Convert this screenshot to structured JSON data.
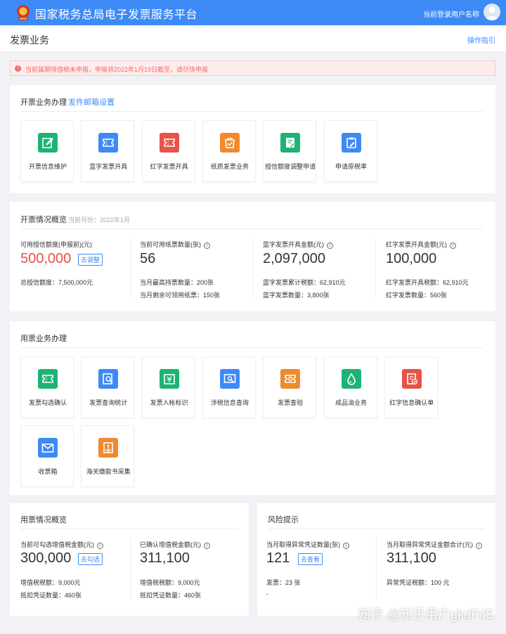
{
  "header": {
    "title": "国家税务总局电子发票服务平台",
    "user_label": "当前登录用户名称"
  },
  "page": {
    "title": "发票业务",
    "guide_label": "操作指引"
  },
  "notice": {
    "text": "当前属期增值税未申报，申报将2022年1月19日截至，请尽快申报"
  },
  "invoicing_business": {
    "title": "开票业务办理",
    "email_link": "发件邮箱设置",
    "tiles": [
      {
        "label": "开票信息维护",
        "icon": "edit-doc-icon",
        "color": "#1db375"
      },
      {
        "label": "蓝字发票开具",
        "icon": "ticket-icon",
        "color": "#3d8af7"
      },
      {
        "label": "红字发票开具",
        "icon": "ticket-icon",
        "color": "#e65348"
      },
      {
        "label": "纸质发票业务",
        "icon": "paper-bag-icon",
        "color": "#ef8a2f"
      },
      {
        "label": "授信额度调整申请",
        "icon": "doc-pen-icon",
        "color": "#1db375"
      },
      {
        "label": "申请原税率",
        "icon": "clipboard-pen-icon",
        "color": "#3d8af7"
      }
    ]
  },
  "invoicing_overview": {
    "title": "开票情况概览",
    "month_label": "当前月份：2022年1月",
    "stats": [
      {
        "label": "可用授信额度(申报前)(元)",
        "value": "500,000",
        "button": "去调整",
        "lines": [
          "总授信额度：7,500,000元"
        ]
      },
      {
        "label": "当前可用纸票数量(张)",
        "value": "56",
        "lines": [
          "当月最高持票数量：200张",
          "当月剩余可领用纸票：150张"
        ]
      },
      {
        "label": "蓝字发票开具金额(元)",
        "value": "2,097,000",
        "lines": [
          "蓝字发票累计税额：62,910元",
          "蓝字发票数量：3,800张"
        ]
      },
      {
        "label": "红字发票开具金额(元)",
        "value": "100,000",
        "lines": [
          "红字发票开具税额：62,910元",
          "红字发票数量：560张"
        ]
      }
    ]
  },
  "usage_business": {
    "title": "用票业务办理",
    "tiles": [
      {
        "label": "发票勾选确认",
        "icon": "ticket-icon",
        "color": "#1db375"
      },
      {
        "label": "发票查询统计",
        "icon": "search-doc-icon",
        "color": "#3d8af7"
      },
      {
        "label": "发票入帐标识",
        "icon": "ledger-icon",
        "color": "#1db375"
      },
      {
        "label": "涉税信息查询",
        "icon": "monitor-search-icon",
        "color": "#3d8af7"
      },
      {
        "label": "发票查验",
        "icon": "ticket-check-icon",
        "color": "#ef8a2f"
      },
      {
        "label": "成品油业务",
        "icon": "oil-drop-icon",
        "color": "#1db375"
      },
      {
        "label": "红字信息确认单",
        "icon": "doc-check-icon",
        "color": "#e65348"
      },
      {
        "label": "收票箱",
        "icon": "mail-icon",
        "color": "#3d8af7"
      },
      {
        "label": "海关缴款书采集",
        "icon": "anchor-doc-icon",
        "color": "#ef8a2f"
      }
    ]
  },
  "usage_overview": {
    "title": "用票情况概览",
    "stats": [
      {
        "label": "当前可勾选增值税金额(元)",
        "value": "300,000",
        "button": "去勾选",
        "lines": [
          "增值税税额：9,000元",
          "抵扣凭证数量：460张"
        ]
      },
      {
        "label": "已确认增值税金额(元)",
        "value": "311,100",
        "lines": [
          "增值税税额：9,000元",
          "抵扣凭证数量：460张"
        ]
      }
    ]
  },
  "risk": {
    "title": "风险提示",
    "stats": [
      {
        "label": "当月取得异常凭证数量(张)",
        "value": "121",
        "button": "去查看",
        "lines": [
          "发票：23 张",
          "-"
        ]
      },
      {
        "label": "当月取得异常凭证金额合计(元)",
        "value": "311,100",
        "lines": [
          "异常凭证税额：100 元"
        ]
      }
    ]
  },
  "watermark": "知乎 @知乎用户gkdP45"
}
